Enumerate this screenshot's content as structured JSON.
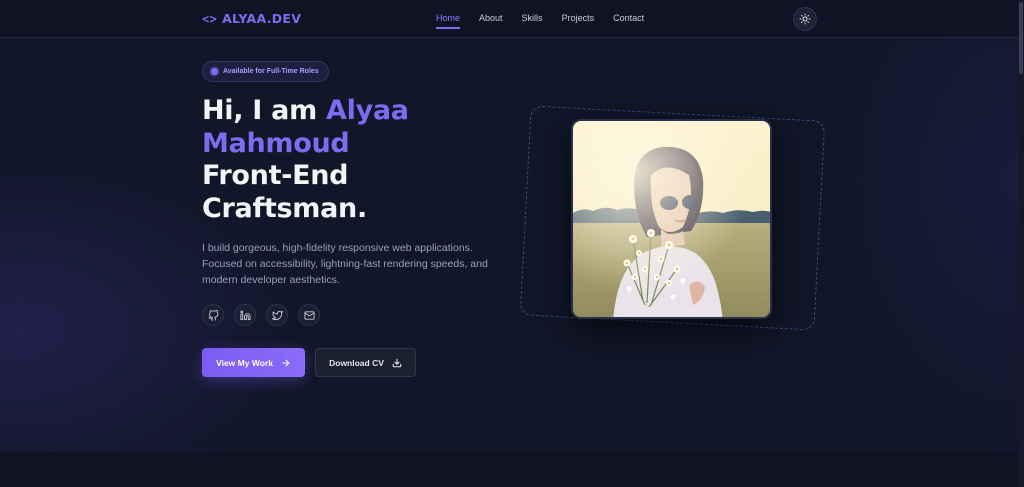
{
  "nav": {
    "logo": "ALYAA.DEV",
    "links": [
      "Home",
      "About",
      "Skills",
      "Projects",
      "Contact"
    ],
    "active_link": "Home"
  },
  "hero": {
    "badge": "Available for Full-Time Roles",
    "headline_prefix": "Hi, I am ",
    "name_line1": "Alyaa",
    "name_line2": "Mahmoud",
    "role_line1": "Front-End",
    "role_line2": "Craftsman.",
    "intro": "I build gorgeous, high-fidelity responsive web applications. Focused on accessibility, lightning-fast rendering speeds, and modern developer aesthetics.",
    "socials": [
      "github-icon",
      "linkedin-icon",
      "twitter-icon",
      "mail-icon"
    ],
    "primary_button": "View My Work",
    "secondary_button": "Download CV"
  },
  "colors": {
    "accent": "#7c6cf0",
    "background": "#111628"
  }
}
